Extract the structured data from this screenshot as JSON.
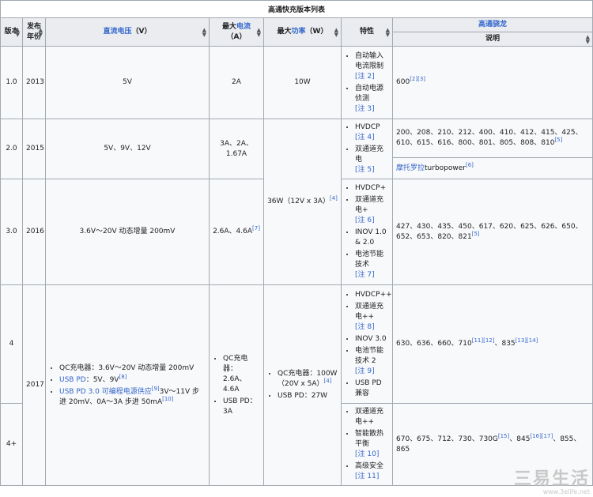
{
  "caption": "高通快充版本列表",
  "headers": {
    "version": "版本",
    "year": "发布年份",
    "voltage_link": "直流电压",
    "voltage_unit": "（V）",
    "current_prefix": "最大",
    "current_link": "电流",
    "current_unit": "（A）",
    "power_prefix": "最大",
    "power_link": "功率",
    "power_unit": "（W）",
    "features": "特性",
    "snapdragon": "高通骁龙",
    "description": "说明"
  },
  "rows": {
    "r1": {
      "version": "1.0",
      "year": "2013",
      "voltage": "5V",
      "current": "2A",
      "power": "10W",
      "f1": "自动输入电流限制",
      "f1_note": "[注 2]",
      "f2": "自动电源侦测",
      "f2_note": "[注 3]",
      "desc": "600",
      "desc_ref": "[2][3]"
    },
    "r2": {
      "version": "2.0",
      "year": "2015",
      "voltage": "5V、9V、12V",
      "current": "3A、2A、1.67A",
      "f1": "HVDCP",
      "f1_note": "[注 4]",
      "f2": "双通道充电",
      "f2_note": "[注 5]",
      "desc": "200、208、210、212、400、410、412、415、425、610、615、616、800、801、805、808、810",
      "desc_ref": "[5]",
      "desc2_link": "摩托罗拉",
      "desc2": "turbopower",
      "desc2_ref": "[6]"
    },
    "r3": {
      "version": "3.0",
      "year": "2016",
      "voltage": "3.6V～20V 动态增量 200mV",
      "current": "2.6A、4.6A",
      "current_ref": "[7]",
      "power": "36W（12V x 3A）",
      "power_ref": "[4]",
      "f1": "HVDCP+",
      "f2": "双通道充电+",
      "f2_note": "[注 6]",
      "f3": "INOV 1.0 & 2.0",
      "f4": "电池节能技术",
      "f4_note": "[注 7]",
      "desc": "427、430、435、450、617、620、625、626、650、652、653、820、821",
      "desc_ref": "[5]"
    },
    "r4": {
      "version": "4",
      "year": "2017",
      "v1": "QC充电器：3.6V～20V 动态增量 200mV",
      "v2_link": "USB PD",
      "v2": "：5V、9V",
      "v2_ref": "[8]",
      "v3_link": "USB PD 3.0 可编程电源供应",
      "v3_ref": "[9]",
      "v3": "3V～11V 步进 20mV、0A～3A 步进 50mA",
      "v3_ref2": "[10]",
      "c1": "QC充电器：2.6A、4.6A",
      "c2": "USB PD：3A",
      "p1": "QC充电器：100W（20V x 5A）",
      "p1_ref": "[4]",
      "p2": "USB PD：27W",
      "f1": "HVDCP++",
      "f2": "双通道充电++",
      "f2_note": "[注 8]",
      "f3": "INOV 3.0",
      "f4": "电池节能技术 2",
      "f4_note": "[注 9]",
      "f5": "USB PD 兼容",
      "desc": "630、636、660、710",
      "desc_ref": "[11][12]",
      "desc_b": "、835",
      "desc_ref2": "[13][14]"
    },
    "r5": {
      "version": "4+",
      "f1": "双通道充电++",
      "f2": "智能散热平衡",
      "f2_note": "[注 10]",
      "f3": "高级安全",
      "f3_note": "[注 11]",
      "desc": "670、675、712、730、730G",
      "desc_ref": "[15]",
      "desc_b": "、845",
      "desc_ref2": "[16][17]",
      "desc_c": "、855、865"
    }
  },
  "watermark": {
    "big": "三易生活",
    "small": "www.3elife.net"
  },
  "colors": {
    "header_bg": "#eaecf0",
    "cell_bg": "#f8f9fa",
    "link": "#3366cc",
    "border": "#a2a9b1"
  }
}
